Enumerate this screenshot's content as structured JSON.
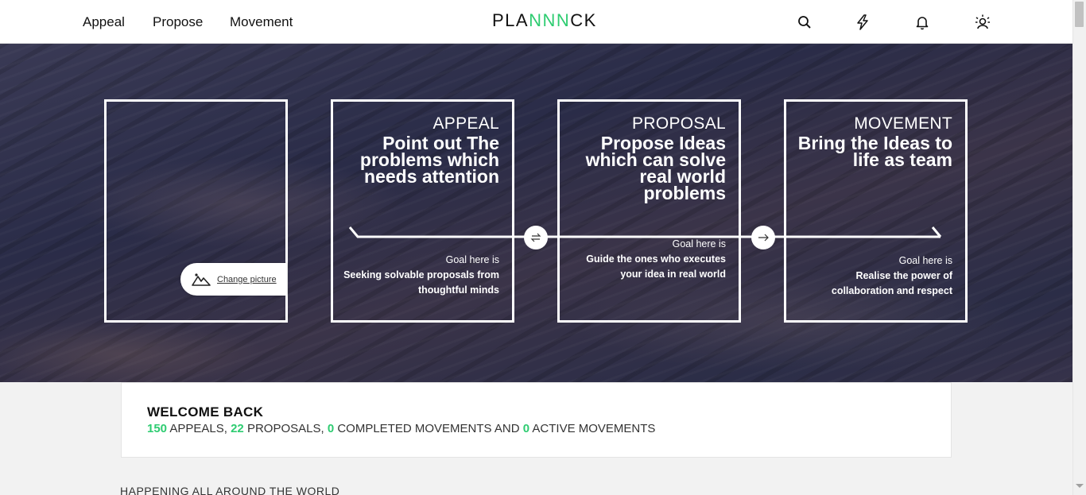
{
  "header": {
    "nav": [
      "Appeal",
      "Propose",
      "Movement"
    ],
    "logo_part1": "PLA",
    "logo_accent": "NNN",
    "logo_part2": "CK",
    "icons": [
      "search-icon",
      "lightning-icon",
      "bell-icon",
      "user-sun-icon"
    ]
  },
  "hero": {
    "change_picture_label": "Change picture",
    "boxes": [
      {
        "title": "APPEAL",
        "headline": "Point out The problems which needs attention",
        "goal_label": "Goal here is",
        "goal_text": "Seeking solvable proposals from thoughtful minds"
      },
      {
        "title": "PROPOSAL",
        "headline": "Propose Ideas which can solve real world problems",
        "goal_label": "Goal here is",
        "goal_text": "Guide the ones who executes your idea in real world"
      },
      {
        "title": "MOVEMENT",
        "headline": "Bring the Ideas to life as team",
        "goal_label": "Goal here is",
        "goal_text": "Realise the power of collaboration and respect"
      }
    ],
    "flow_icons": [
      "swap-arrows-icon",
      "arrow-right-icon"
    ]
  },
  "welcome": {
    "title": "WELCOME BACK",
    "appeals_count": "150",
    "appeals_label": "APPEALS,",
    "proposals_count": "22",
    "proposals_label": "PROPOSALS,",
    "completed_count": "0",
    "completed_label": "COMPLETED MOVEMENTS AND",
    "active_count": "0",
    "active_label": "ACTIVE MOVEMENTS"
  },
  "section": {
    "label": "HAPPENING ALL AROUND THE WORLD"
  },
  "colors": {
    "accent": "#2ecc71",
    "hero_bg": "#2c2d47"
  }
}
